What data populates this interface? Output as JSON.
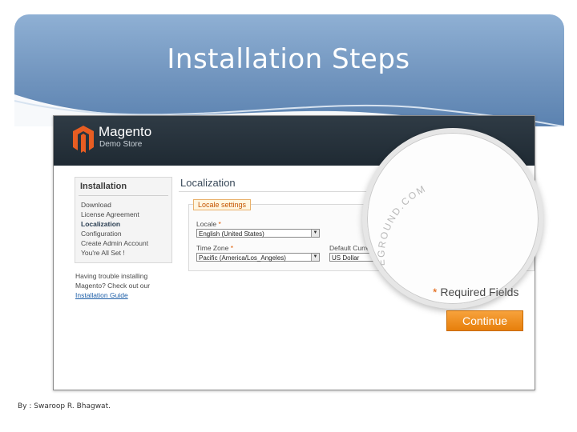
{
  "slide": {
    "title": "Installation Steps",
    "byline": "By : Swaroop R. Bhagwat."
  },
  "app": {
    "brand": "Magento",
    "store": "Demo Store"
  },
  "sidebar": {
    "title": "Installation",
    "items": [
      {
        "label": "Download"
      },
      {
        "label": "License Agreement"
      },
      {
        "label": "Localization"
      },
      {
        "label": "Configuration"
      },
      {
        "label": "Create Admin Account"
      },
      {
        "label": "You're All Set !"
      }
    ],
    "active_item": "Localization",
    "help_text": "Having trouble installing Magento? Check out our",
    "help_link": "Installation Guide"
  },
  "main": {
    "title": "Localization",
    "section_tab": "Locale settings",
    "fields": {
      "locale": {
        "label": "Locale",
        "value": "English (United States)"
      },
      "timezone": {
        "label": "Time Zone",
        "value": "Pacific (America/Los_Angeles)"
      },
      "currency": {
        "label": "Default Currency",
        "value": "US Dollar"
      }
    },
    "required_mark": "*"
  },
  "magnifier": {
    "watermark": "SITEGROUND.COM",
    "required_fields": "Required Fields",
    "required_star": "*",
    "continue_label": "Continue"
  },
  "colors": {
    "accent": "#e77f0b",
    "header": "#1f2a33",
    "band": "#6f93bd"
  }
}
